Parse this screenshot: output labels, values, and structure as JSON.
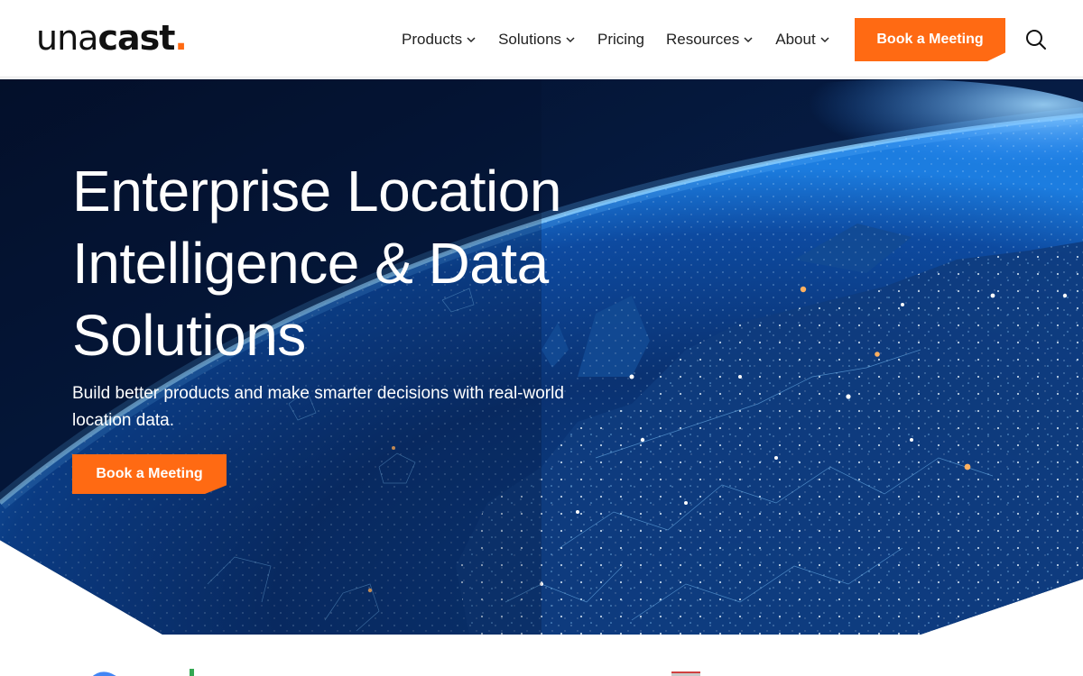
{
  "brand": {
    "logo_light": "una",
    "logo_bold": "cast",
    "logo_dot": ".",
    "accent_color": "#ff6a13"
  },
  "nav": {
    "items": [
      {
        "label": "Products",
        "has_dropdown": true
      },
      {
        "label": "Solutions",
        "has_dropdown": true
      },
      {
        "label": "Pricing",
        "has_dropdown": false
      },
      {
        "label": "Resources",
        "has_dropdown": true
      },
      {
        "label": "About",
        "has_dropdown": true
      }
    ],
    "cta_label": "Book a Meeting",
    "search_icon": "search-icon"
  },
  "hero": {
    "title": "Enterprise Location Intelligence & Data Solutions",
    "subtitle": "Build better products and make smarter decisions with real-world location data.",
    "cta_label": "Book a Meeting",
    "background": "earth-at-night-network-image"
  }
}
